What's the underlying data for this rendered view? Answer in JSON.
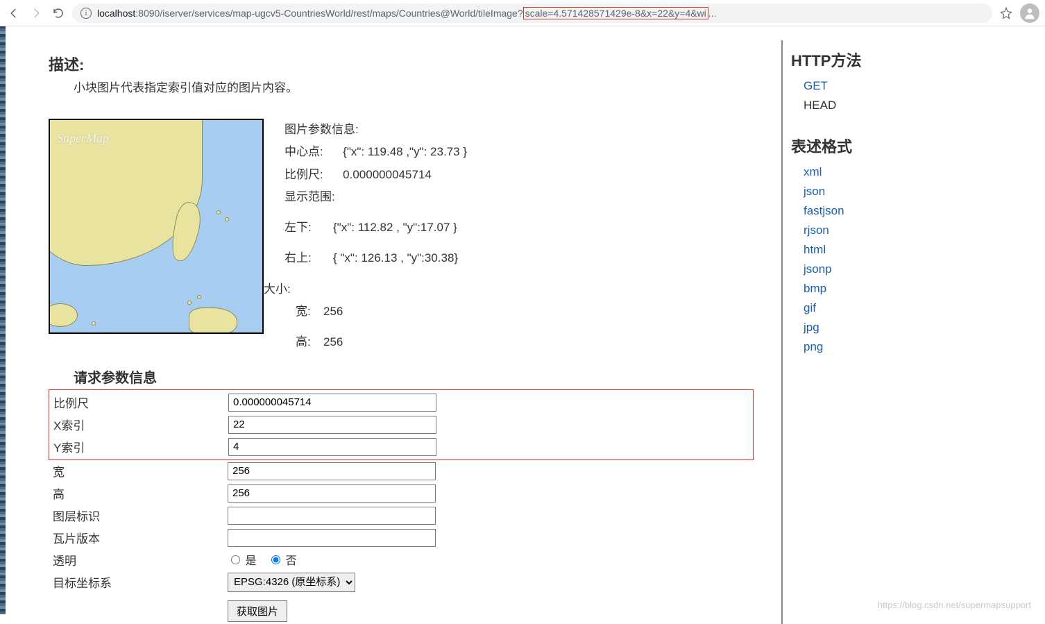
{
  "browser": {
    "host": "localhost",
    "port": ":8090",
    "path": "/iserver/services/map-ugcv5-CountriesWorld/rest/maps/Countries@World/tileImage?",
    "query_highlight": "scale=4.571428571429e-8&x=22&y=4&wi",
    "query_tail": "..."
  },
  "desc": {
    "title": "描述:",
    "text": "小块图片代表指定索引值对应的图片内容。"
  },
  "map": {
    "watermark": "SuperMap"
  },
  "info": {
    "header": "图片参数信息:",
    "center_k": "中心点:",
    "center_v": "{\"x\": 119.48 ,\"y\": 23.73 }",
    "scale_k": "比例尺:",
    "scale_v": "0.000000045714",
    "extent_k": "显示范围:",
    "bl_k": "左下:",
    "bl_v": "{\"x\": 112.82 , \"y\":17.07 }",
    "tr_k": "右上:",
    "tr_v": "{ \"x\": 126.13 , \"y\":30.38}",
    "size_k": "大小:",
    "w_k": "宽:",
    "w_v": "256",
    "h_k": "高:",
    "h_v": "256"
  },
  "params": {
    "title": "请求参数信息",
    "rows": {
      "scale_label": "比例尺",
      "scale_value": "0.000000045714",
      "x_label": "X索引",
      "x_value": "22",
      "y_label": "Y索引",
      "y_value": "4",
      "w_label": "宽",
      "w_value": "256",
      "h_label": "高",
      "h_value": "256",
      "layer_label": "图层标识",
      "layer_value": "",
      "tilever_label": "瓦片版本",
      "tilever_value": "",
      "transparent_label": "透明",
      "yes": "是",
      "no": "否",
      "crs_label": "目标坐标系",
      "crs_value": "EPSG:4326 (原坐标系)",
      "button": "获取图片"
    }
  },
  "sidebar": {
    "http_title": "HTTP方法",
    "http_items": [
      {
        "label": "GET",
        "link": true
      },
      {
        "label": "HEAD",
        "link": false
      }
    ],
    "fmt_title": "表述格式",
    "fmt_items": [
      "xml",
      "json",
      "fastjson",
      "rjson",
      "html",
      "jsonp",
      "bmp",
      "gif",
      "jpg",
      "png"
    ]
  },
  "footer_wm": "https://blog.csdn.net/supermapsupport"
}
